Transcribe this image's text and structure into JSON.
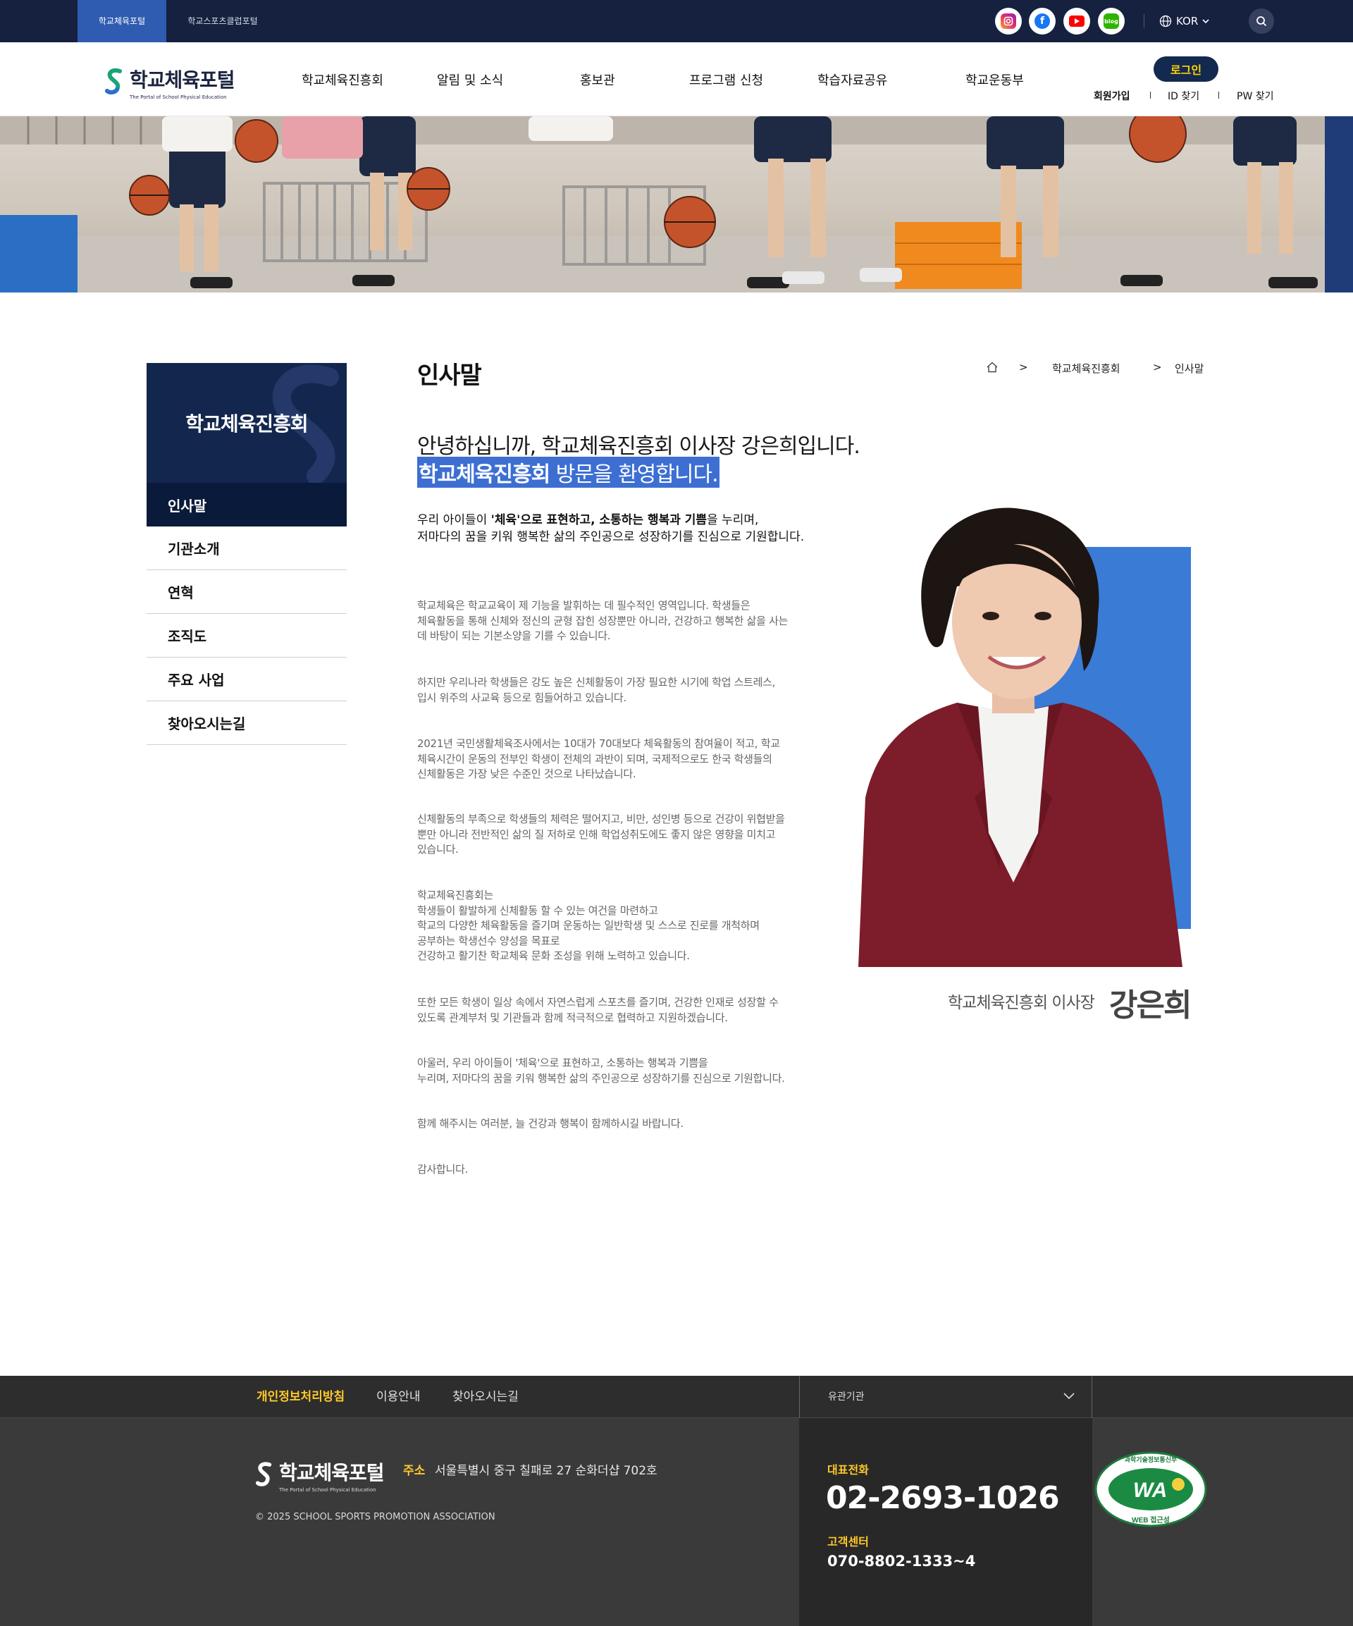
{
  "topbar": {
    "portal_tabs": [
      "학교체육포털",
      "학교스포츠클럽포털"
    ],
    "sns": [
      {
        "icon": "instagram-icon",
        "color": "#e1306c"
      },
      {
        "icon": "facebook-icon",
        "color": "#1877f2"
      },
      {
        "icon": "youtube-icon",
        "color": "#ff0000"
      },
      {
        "icon": "blog-icon",
        "color": "#2db400"
      }
    ],
    "language": "KOR"
  },
  "header": {
    "logo_title": "학교체육포털",
    "logo_sub": "The Portal of School Physical Education",
    "nav": [
      "학교체육진흥회",
      "알림 및 소식",
      "홍보관",
      "프로그램 신청",
      "학습자료공유",
      "학교운동부"
    ],
    "login": "로그인",
    "member_links": [
      "회원가입",
      "ID 찾기",
      "PW 찾기"
    ]
  },
  "sidebar": {
    "title": "학교체육진흥회",
    "items": [
      "인사말",
      "기관소개",
      "연혁",
      "조직도",
      "주요 사업",
      "찾아오시는길"
    ],
    "active_index": 0
  },
  "content": {
    "page_title": "인사말",
    "breadcrumb": [
      "학교체육진흥회",
      "인사말"
    ],
    "headline1": "안녕하십니까, 학교체육진흥회 이사장 강은희입니다.",
    "headline2_bold": "학교체육진흥회",
    "headline2_rest": " 방문을 환영합니다.",
    "lead_pre": "우리 아이들이 ",
    "lead_bold1": "'체육'으로 표현하고, 소통하는 행복과 기쁨",
    "lead_post": "을 누리며,",
    "lead_line2": "저마다의 꿈을 키워 행복한 삶의 주인공으로 성장하기를 진심으로 기원합니다.",
    "paragraphs": [
      "학교체육은 학교교육이 제 기능을 발휘하는 데 필수적인 영역입니다. 학생들은\n체육활동을 통해 신체와 정신의 균형 잡힌 성장뿐만 아니라, 건강하고 행복한 삶을 사는\n데 바탕이 되는 기본소양을 기를 수 있습니다.",
      "하지만 우리나라 학생들은 강도 높은 신체활동이 가장 필요한 시기에 학업 스트레스,\n입시 위주의 사교육 등으로 힘들어하고 있습니다.",
      "2021년 국민생활체육조사에서는 10대가 70대보다 체육활동의 참여율이 적고, 학교\n체육시간이 운동의 전부인 학생이 전체의 과반이 되며, 국제적으로도 한국 학생들의\n신체활동은 가장 낮은 수준인 것으로 나타났습니다.",
      "신체활동의 부족으로 학생들의 체력은 떨어지고, 비만, 성인병 등으로 건강이 위협받을\n뿐만 아니라 전반적인 삶의 질 저하로 인해 학업성취도에도 좋지 않은 영향을 미치고\n있습니다.",
      "학교체육진흥회는\n학생들이 활발하게 신체활동 할 수 있는 여건을 마련하고\n학교의 다양한 체육활동을 즐기며 운동하는 일반학생 및 스스로 진로를 개척하며\n공부하는 학생선수 양성을 목표로\n건강하고 활기찬 학교체육 문화 조성을 위해 노력하고 있습니다.",
      "또한 모든 학생이 일상 속에서 자연스럽게 스포츠를 즐기며, 건강한 인재로 성장할 수\n있도록 관계부처 및 기관들과 함께 적극적으로 협력하고 지원하겠습니다.",
      "아울러, 우리 아이들이 '체육'으로 표현하고, 소통하는 행복과 기쁨을\n누리며, 저마다의 꿈을 키워 행복한 삶의 주인공으로 성장하기를 진심으로 기원합니다.",
      "함께 해주시는 여러분, 늘 건강과 행복이 함께하시길 바랍니다.",
      "감사합니다."
    ],
    "ceo_title": "학교체육진흥회 이사장",
    "ceo_name": "강은희"
  },
  "footer": {
    "links": [
      "개인정보처리방침",
      "이용안내",
      "찾아오시는길"
    ],
    "family_select": "유관기관",
    "logo_title": "학교체육포털",
    "logo_sub": "The Portal of School Physical Education",
    "address_label": "주소",
    "address": "서울특별시 중구 칠패로 27 순화더샵 702호",
    "copyright": "© 2025 SCHOOL SPORTS PROMOTION ASSOCIATION",
    "tel_label": "대표전화",
    "tel": "02-2693-1026",
    "cs_label": "고객센터",
    "cs_tel": "070-8802-1333~4",
    "wa_text": "WA",
    "wa_top": "과학기술정보통신부",
    "wa_bottom": "WEB 접근성"
  },
  "colors": {
    "navy": "#15213f",
    "accent_blue": "#2f5bb0",
    "highlight": "#3d6fd3",
    "footer_yellow": "#ffc928"
  }
}
